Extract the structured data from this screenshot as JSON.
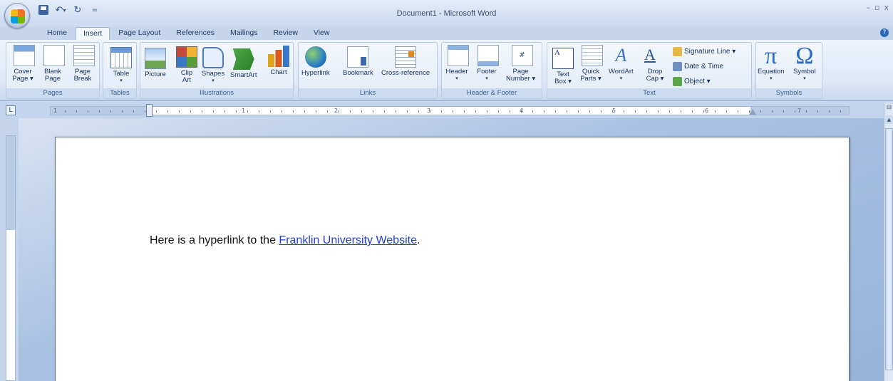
{
  "window": {
    "title": "Document1 - Microsoft Word",
    "controls": {
      "minimize": "–",
      "restore": "▫",
      "close": "x"
    },
    "help": "?"
  },
  "qat": {
    "undo": "↶",
    "undo_arrow": "▾",
    "redo": "↻",
    "customize": "="
  },
  "tabs": [
    "Home",
    "Insert",
    "Page Layout",
    "References",
    "Mailings",
    "Review",
    "View"
  ],
  "active_tab": "Insert",
  "ribbon": {
    "groups": {
      "pages": "Pages",
      "tables": "Tables",
      "illustrations": "Illustrations",
      "links": "Links",
      "header_footer": "Header & Footer",
      "text": "Text",
      "symbols": "Symbols"
    },
    "buttons": {
      "cover_page": "Cover\nPage ▾",
      "blank_page": "Blank\nPage",
      "page_break": "Page\nBreak",
      "table": "Table",
      "picture": "Picture",
      "clip_art": "Clip\nArt",
      "shapes": "Shapes",
      "smartart": "SmartArt",
      "chart": "Chart",
      "hyperlink": "Hyperlink",
      "bookmark": "Bookmark",
      "cross_reference": "Cross-reference",
      "header": "Header",
      "footer": "Footer",
      "page_number": "Page\nNumber ▾",
      "text_box": "Text\nBox ▾",
      "quick_parts": "Quick\nParts ▾",
      "wordart": "WordArt",
      "drop_cap": "Drop\nCap ▾",
      "signature_line": "Signature Line ▾",
      "date_time": "Date & Time",
      "object": "Object ▾",
      "equation": "Equation",
      "symbol": "Symbol"
    },
    "glyphs": {
      "dropdown": "▾",
      "page_number_glyph": "#",
      "textbox_glyph": "A",
      "wordart_glyph": "A",
      "dropcap_glyph": "A",
      "equation_glyph": "π",
      "symbol_glyph": "Ω"
    }
  },
  "ruler": {
    "corner": "L",
    "numbers": [
      "1",
      "1",
      "2",
      "3",
      "4",
      "5",
      "6",
      "7"
    ]
  },
  "document": {
    "text_before": "Here is a hyperlink to the ",
    "link_text": "Franklin University Website",
    "text_after": "."
  },
  "colors": {
    "hyperlink": "#1f3fcf",
    "ribbon": "#dde8f6",
    "accent": "#2a6bc4"
  }
}
